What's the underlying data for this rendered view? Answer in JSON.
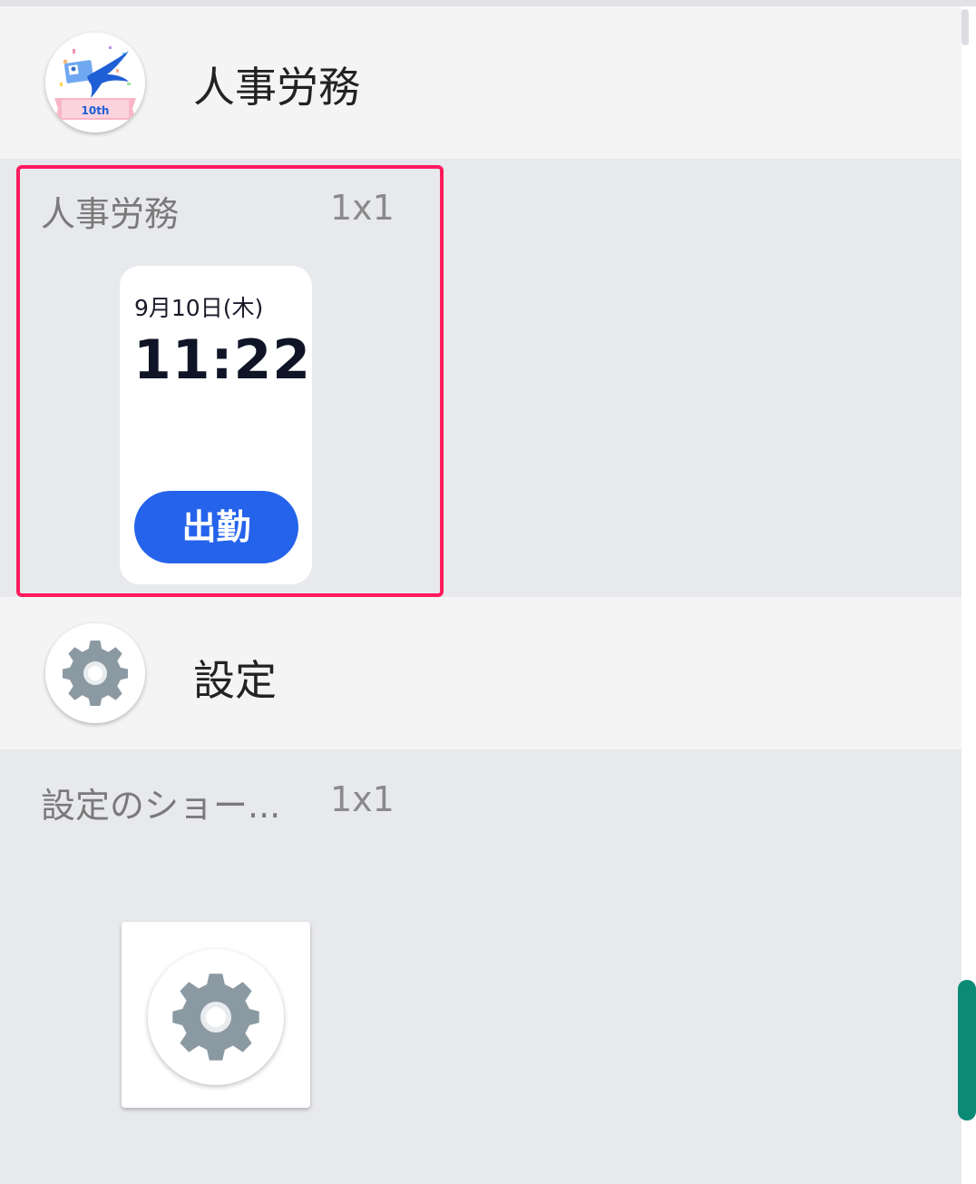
{
  "apps": [
    {
      "name": "人事労務",
      "icon": "hr-app-10th-anniversary-icon",
      "widget": {
        "label": "人事労務",
        "size": "1x1",
        "date": "9月10日(木)",
        "time": "11:22",
        "button_label": "出勤",
        "button_color": "#2563eb"
      }
    },
    {
      "name": "設定",
      "icon": "gear-icon",
      "widget": {
        "label": "設定のショー...",
        "size": "1x1",
        "preview_icon": "gear-icon"
      }
    }
  ],
  "highlight_color": "#ff1a5e",
  "scrollbar_color": "#0b8a76"
}
